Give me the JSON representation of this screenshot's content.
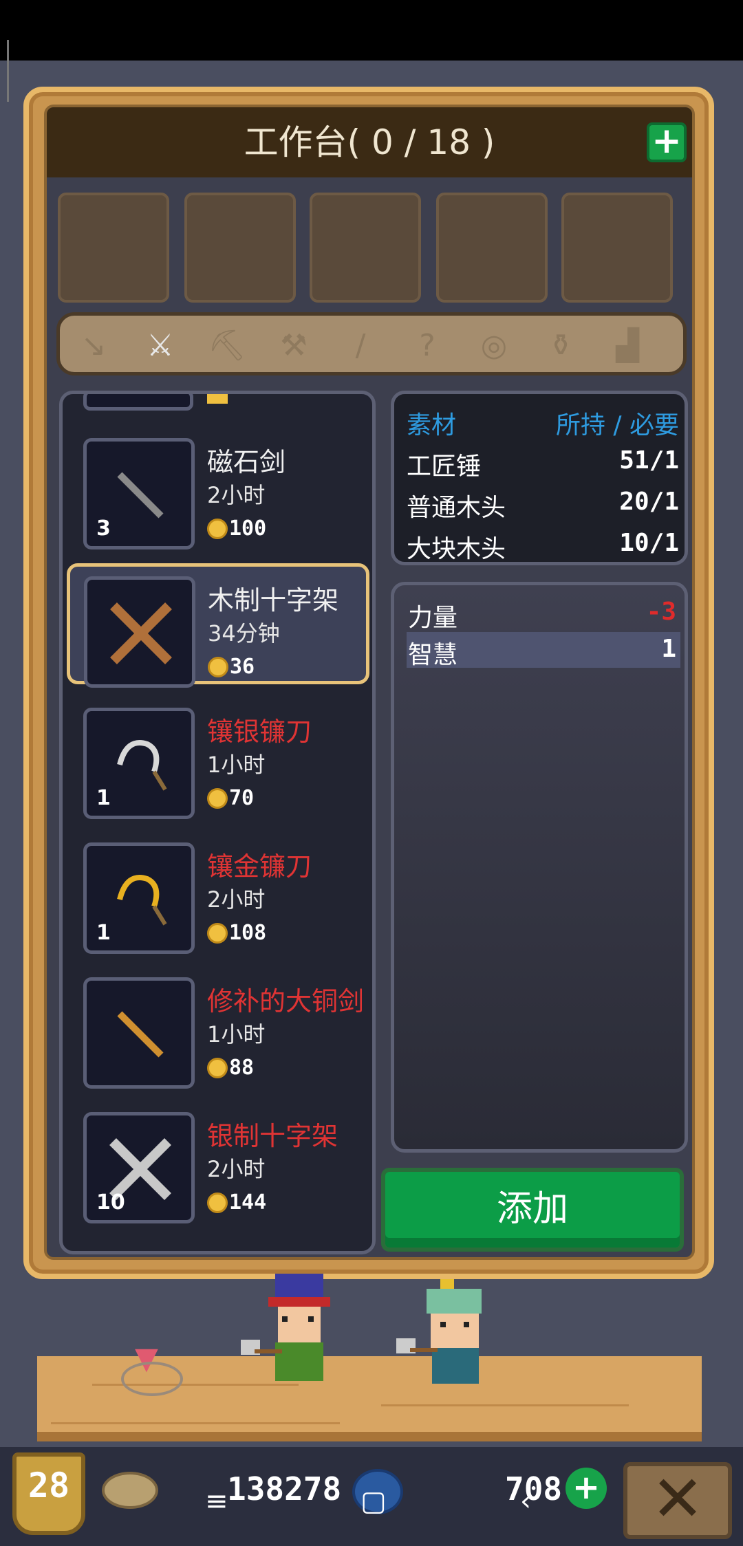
{
  "workbench": {
    "title": "工作台( 0 / 18 )",
    "add_icon": "+"
  },
  "tabs": [
    {
      "icon": "arrow-icon",
      "glyph": "↘"
    },
    {
      "icon": "sword-icon",
      "glyph": "⚔"
    },
    {
      "icon": "axe-icon",
      "glyph": "⛏"
    },
    {
      "icon": "hammer-icon",
      "glyph": "⚒"
    },
    {
      "icon": "spear-icon",
      "glyph": "/"
    },
    {
      "icon": "question-icon",
      "glyph": "?"
    },
    {
      "icon": "bow-icon",
      "glyph": "◎"
    },
    {
      "icon": "pot-icon",
      "glyph": "⚱"
    },
    {
      "icon": "bucket-icon",
      "glyph": "▟"
    }
  ],
  "recipes": [
    {
      "name": "磁石剑",
      "time": "2小时",
      "price": "100",
      "count": "3",
      "name_color": "white",
      "icon": "magnet-sword-icon"
    },
    {
      "name": "木制十字架",
      "time": "34分钟",
      "price": "36",
      "count": "",
      "name_color": "white",
      "icon": "wooden-cross-icon",
      "selected": true
    },
    {
      "name": "镶银镰刀",
      "time": "1小时",
      "price": "70",
      "count": "1",
      "name_color": "red",
      "icon": "silver-sickle-icon"
    },
    {
      "name": "镶金镰刀",
      "time": "2小时",
      "price": "108",
      "count": "1",
      "name_color": "red",
      "icon": "gold-sickle-icon"
    },
    {
      "name": "修补的大铜剑",
      "time": "1小时",
      "price": "88",
      "count": "",
      "name_color": "red",
      "icon": "bronze-sword-icon"
    },
    {
      "name": "银制十字架",
      "time": "2小时",
      "price": "144",
      "count": "10",
      "name_color": "red",
      "icon": "silver-cross-icon"
    }
  ],
  "requirements": {
    "header_left": "素材",
    "header_right": "所持 / 必要",
    "rows": [
      {
        "name": "工匠锤",
        "value": "51/1"
      },
      {
        "name": "普通木头",
        "value": "20/1"
      },
      {
        "name": "大块木头",
        "value": "10/1"
      }
    ]
  },
  "stats": [
    {
      "name": "力量",
      "value": "-3",
      "color": "#e02b2b"
    },
    {
      "name": "智慧",
      "value": "1",
      "color": "#ffffff"
    }
  ],
  "add_button": "添加",
  "hud": {
    "level": "28",
    "gold": "138278",
    "gems": "708",
    "plus": "+",
    "close": "✕"
  },
  "navbar": {
    "menu": "≡",
    "home": "▢",
    "back": "‹"
  }
}
